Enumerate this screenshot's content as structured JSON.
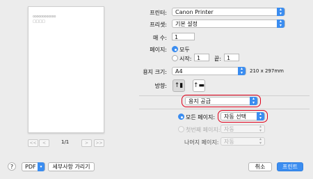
{
  "preview": {
    "placeholder_line1": "oooooooooooo",
    "placeholder_line2": "□□□□",
    "page_indicator": "1/1",
    "first_glyph": "<<",
    "prev_glyph": "<",
    "next_glyph": ">",
    "last_glyph": ">>"
  },
  "printer": {
    "label": "프린터:",
    "value": "Canon Printer"
  },
  "preset": {
    "label": "프리셋:",
    "value": "기본 설정"
  },
  "copies": {
    "label": "매 수:",
    "value": "1"
  },
  "pages": {
    "label": "페이지:",
    "all_label": "모두",
    "from_label": "시작:",
    "from_value": "1",
    "to_label": "끝:",
    "to_value": "1"
  },
  "paper_size": {
    "label": "용지 크기:",
    "value": "A4",
    "dimensions": "210 x 297mm"
  },
  "orientation": {
    "label": "방향:"
  },
  "section_popup": {
    "value": "용지 공급"
  },
  "paper_feed": {
    "all_pages_label": "모든 페이지:",
    "all_pages_value": "자동 선택",
    "first_page_label": "첫번째 페이지:",
    "first_page_value": "자동",
    "remaining_label": "나머지 페이지:",
    "remaining_value": "자동"
  },
  "footer": {
    "help": "?",
    "pdf_label": "PDF",
    "show_details": "세부사항 가리기",
    "cancel": "취소",
    "print": "프린트"
  },
  "colors": {
    "accent": "#3b8df0",
    "highlight": "#e0001a"
  }
}
